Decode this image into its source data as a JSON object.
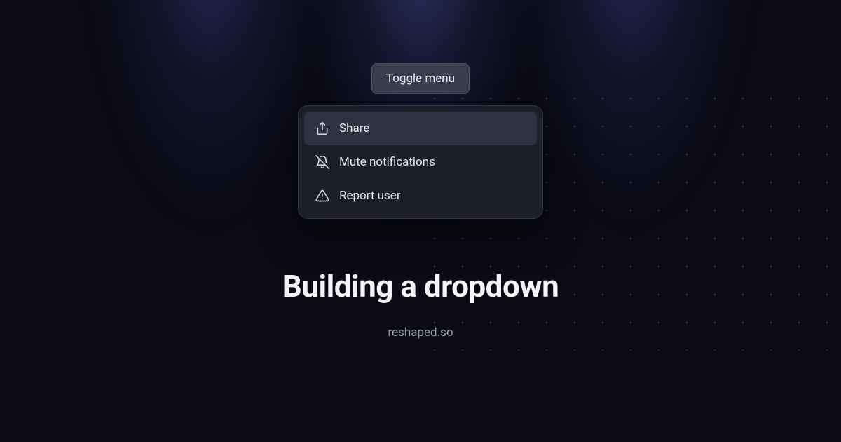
{
  "toggle_button_label": "Toggle menu",
  "menu": {
    "items": [
      {
        "label": "Share",
        "icon": "share-icon"
      },
      {
        "label": "Mute notifications",
        "icon": "bell-off-icon"
      },
      {
        "label": "Report user",
        "icon": "alert-triangle-icon"
      }
    ]
  },
  "heading": "Building a dropdown",
  "site_url": "reshaped.so"
}
